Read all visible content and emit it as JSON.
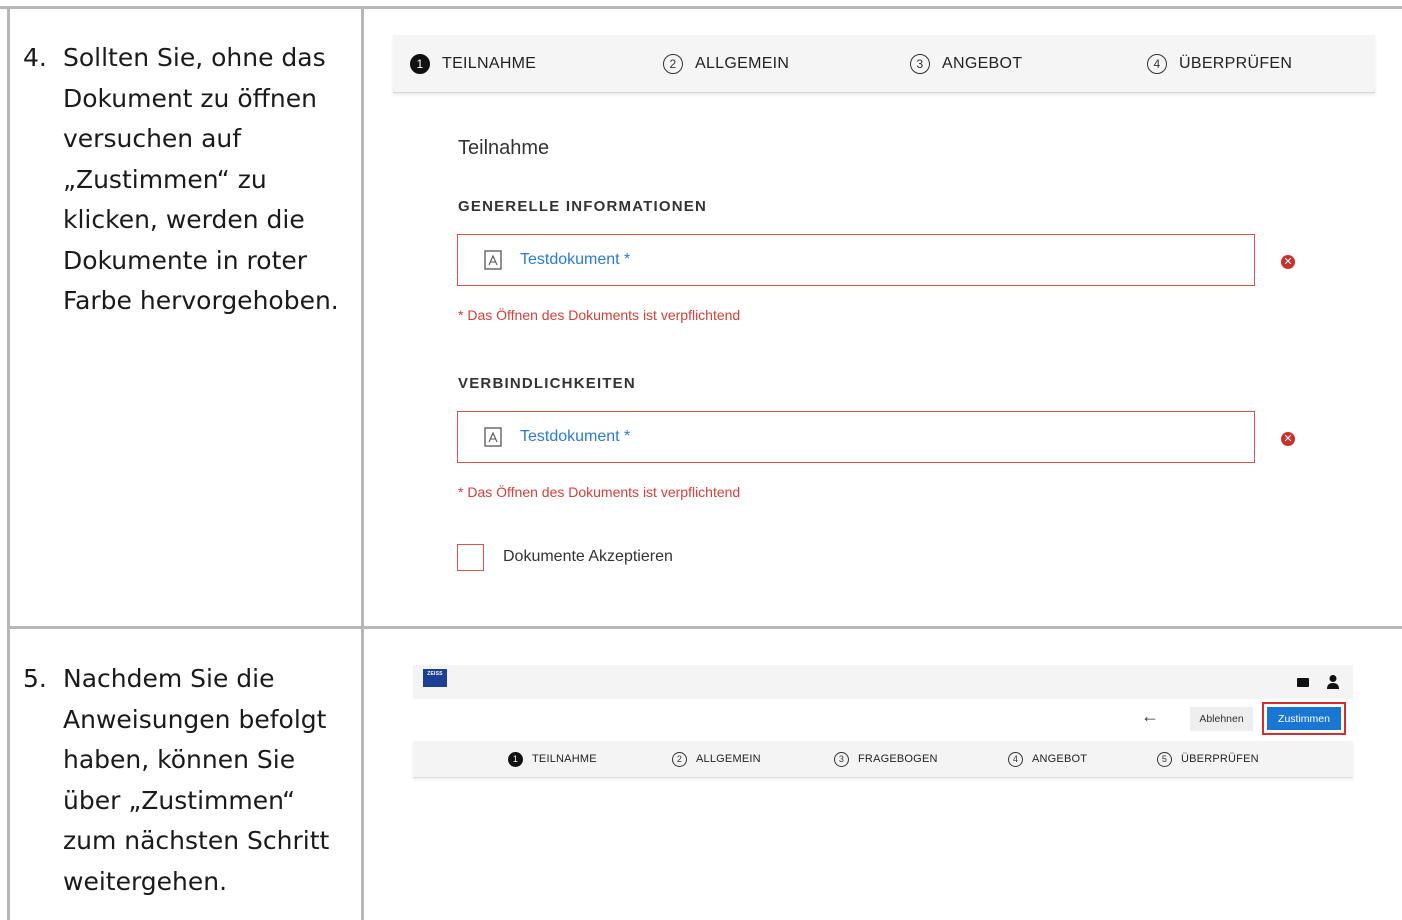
{
  "row1": {
    "number": "4.",
    "instruction_lines": [
      "Sollten Sie, ohne das",
      "Dokument zu öffnen",
      "versuchen auf",
      "„Zustimmen“ zu",
      "klicken, werden die",
      "Dokumente in roter",
      "Farbe hervorgehoben."
    ],
    "steps": [
      {
        "num": "1",
        "label": "TEILNAHME",
        "active": true
      },
      {
        "num": "2",
        "label": "ALLGEMEIN",
        "active": false
      },
      {
        "num": "3",
        "label": "ANGEBOT",
        "active": false
      },
      {
        "num": "4",
        "label": "ÜBERPRÜFEN",
        "active": false
      }
    ],
    "section_title": "Teilnahme",
    "groups": [
      {
        "heading": "GENERELLE INFORMATIONEN",
        "doc_label": "Testdokument *",
        "error": "* Das Öffnen des Dokuments ist verpflichtend",
        "error_icon": "x-circle-icon"
      },
      {
        "heading": "VERBINDLICHKEITEN",
        "doc_label": "Testdokument *",
        "error": "* Das Öffnen des Dokuments ist verpflichtend",
        "error_icon": "x-circle-icon"
      }
    ],
    "checkbox_label": "Dokumente Akzeptieren",
    "checkbox_checked": false
  },
  "row2": {
    "number": "5.",
    "instruction_lines": [
      "Nachdem Sie die",
      "Anweisungen befolgt",
      "haben, können Sie",
      "über „Zustimmen“",
      "zum nächsten Schritt",
      "weitergehen."
    ],
    "logo_text": "ZEISS",
    "back_arrow": "←",
    "decline_label": "Ablehnen",
    "agree_label": "Zustimmen",
    "steps": [
      {
        "num": "1",
        "label": "TEILNAHME",
        "active": true
      },
      {
        "num": "2",
        "label": "ALLGEMEIN",
        "active": false
      },
      {
        "num": "3",
        "label": "FRAGEBOGEN",
        "active": false
      },
      {
        "num": "4",
        "label": "ANGEBOT",
        "active": false
      },
      {
        "num": "5",
        "label": "ÜBERPRÜFEN",
        "active": false
      }
    ]
  },
  "colors": {
    "error": "#d9534f",
    "link": "#2a7ad6",
    "primary_button": "#1976d2",
    "highlight_frame": "#d32f2f",
    "logo": "#1d3f93"
  }
}
